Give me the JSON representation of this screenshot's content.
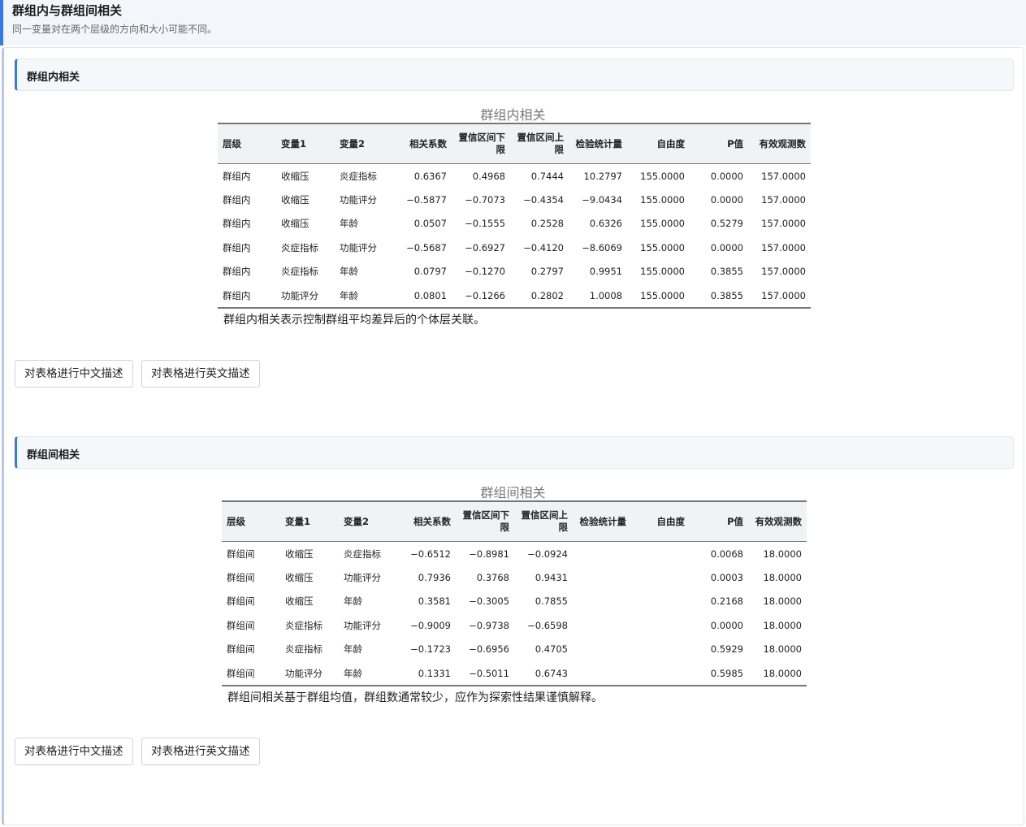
{
  "page": {
    "title": "群组内与群组间相关",
    "subtitle": "同一变量对在两个层级的方向和大小可能不同。"
  },
  "within": {
    "section_title": "群组内相关",
    "table_title": "群组内相关",
    "headers": [
      "层级",
      "变量1",
      "变量2",
      "相关系数",
      "置信区间下限",
      "置信区间上限",
      "检验统计量",
      "自由度",
      "P值",
      "有效观测数"
    ],
    "rows": [
      [
        "群组内",
        "收缩压",
        "炎症指标",
        "0.6367",
        "0.4968",
        "0.7444",
        "10.2797",
        "155.0000",
        "0.0000",
        "157.0000"
      ],
      [
        "群组内",
        "收缩压",
        "功能评分",
        "−0.5877",
        "−0.7073",
        "−0.4354",
        "−9.0434",
        "155.0000",
        "0.0000",
        "157.0000"
      ],
      [
        "群组内",
        "收缩压",
        "年龄",
        "0.0507",
        "−0.1555",
        "0.2528",
        "0.6326",
        "155.0000",
        "0.5279",
        "157.0000"
      ],
      [
        "群组内",
        "炎症指标",
        "功能评分",
        "−0.5687",
        "−0.6927",
        "−0.4120",
        "−8.6069",
        "155.0000",
        "0.0000",
        "157.0000"
      ],
      [
        "群组内",
        "炎症指标",
        "年龄",
        "0.0797",
        "−0.1270",
        "0.2797",
        "0.9951",
        "155.0000",
        "0.3855",
        "157.0000"
      ],
      [
        "群组内",
        "功能评分",
        "年龄",
        "0.0801",
        "−0.1266",
        "0.2802",
        "1.0008",
        "155.0000",
        "0.3855",
        "157.0000"
      ]
    ],
    "note": "群组内相关表示控制群组平均差异后的个体层关联。",
    "btn_cn": "对表格进行中文描述",
    "btn_en": "对表格进行英文描述"
  },
  "between": {
    "section_title": "群组间相关",
    "table_title": "群组间相关",
    "headers": [
      "层级",
      "变量1",
      "变量2",
      "相关系数",
      "置信区间下限",
      "置信区间上限",
      "检验统计量",
      "自由度",
      "P值",
      "有效观测数"
    ],
    "rows": [
      [
        "群组间",
        "收缩压",
        "炎症指标",
        "−0.6512",
        "−0.8981",
        "−0.0924",
        "",
        "",
        "0.0068",
        "18.0000"
      ],
      [
        "群组间",
        "收缩压",
        "功能评分",
        "0.7936",
        "0.3768",
        "0.9431",
        "",
        "",
        "0.0003",
        "18.0000"
      ],
      [
        "群组间",
        "收缩压",
        "年龄",
        "0.3581",
        "−0.3005",
        "0.7855",
        "",
        "",
        "0.2168",
        "18.0000"
      ],
      [
        "群组间",
        "炎症指标",
        "功能评分",
        "−0.9009",
        "−0.9738",
        "−0.6598",
        "",
        "",
        "0.0000",
        "18.0000"
      ],
      [
        "群组间",
        "炎症指标",
        "年龄",
        "−0.1723",
        "−0.6956",
        "0.4705",
        "",
        "",
        "0.5929",
        "18.0000"
      ],
      [
        "群组间",
        "功能评分",
        "年龄",
        "0.1331",
        "−0.5011",
        "0.6743",
        "",
        "",
        "0.5985",
        "18.0000"
      ]
    ],
    "note": "群组间相关基于群组均值，群组数通常较少，应作为探索性结果谨慎解释。",
    "btn_cn": "对表格进行中文描述",
    "btn_en": "对表格进行英文描述"
  }
}
